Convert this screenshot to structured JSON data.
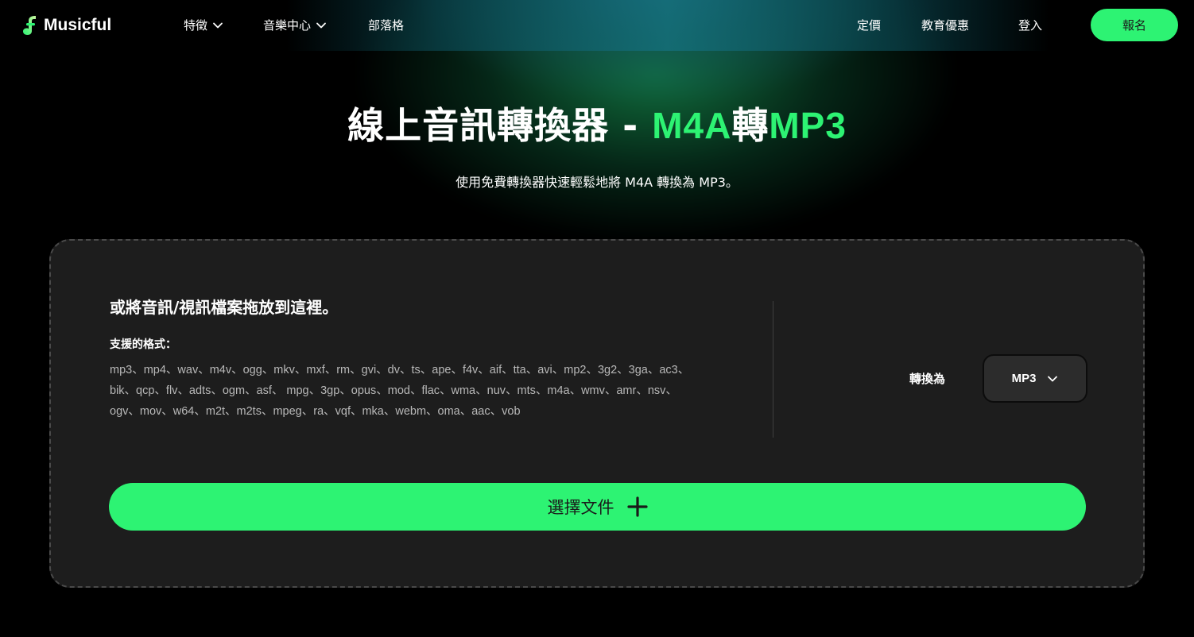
{
  "header": {
    "brand": "Musicful",
    "nav": [
      {
        "label": "特徵"
      },
      {
        "label": "音樂中心"
      },
      {
        "label": "部落格"
      }
    ],
    "right_links": [
      {
        "label": "定價"
      },
      {
        "label": "教育優惠"
      },
      {
        "label": "登入"
      }
    ],
    "signup_label": "報名"
  },
  "hero": {
    "title_prefix": "線上音訊轉換器",
    "title_dash": "-",
    "title_from": "M4A",
    "title_mid": "轉",
    "title_to": "MP3",
    "subtitle": "使用免費轉換器快速輕鬆地將 M4A 轉換為 MP3。"
  },
  "converter": {
    "drop_title": "或將音訊/視訊檔案拖放到這裡。",
    "formats_label": "支援的格式：",
    "formats_line1": "mp3、mp4、wav、m4v、ogg、mkv、mxf、rm、gvi、dv、ts、ape、f4v、aif、tta、avi、mp2、3g2、3ga、ac3、",
    "formats_line2": "bik、qcp、flv、adts、ogm、asf、 mpg、3gp、opus、mod、flac、wma、nuv、mts、m4a、wmv、amr、nsv、",
    "formats_line3": "ogv、mov、w64、m2t、m2ts、mpeg、ra、vqf、mka、webm、oma、aac、vob",
    "convert_to_label": "轉換為",
    "selected_format": "MP3",
    "choose_file_label": "選擇文件"
  },
  "colors": {
    "accent": "#2df373",
    "background": "#000000",
    "panel": "#1d1d1d"
  },
  "icons": {
    "logo": "music-note-logo-icon",
    "dropdown": "chevron-down-icon",
    "add": "plus-icon"
  }
}
